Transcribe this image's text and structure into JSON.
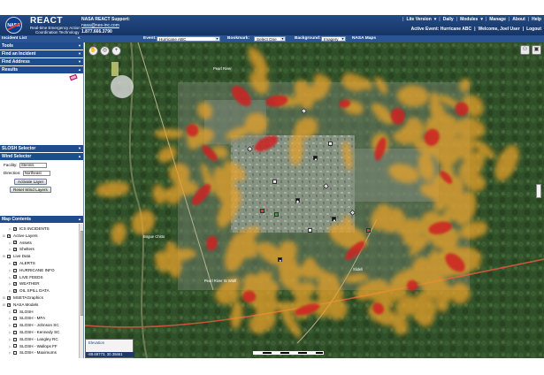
{
  "header": {
    "logo_text": "NASA",
    "title": "REACT",
    "subtitle_line1": "Real-time Emergency Action",
    "subtitle_line2": "Coordination Technology",
    "support_title": "NASA REACT Support:",
    "support_email": "nasa@nes-inc.com",
    "support_phone": "1.877.666.3790",
    "nav": [
      "Lite Version",
      "Daily",
      "Modules",
      "Manage",
      "About",
      "Help"
    ],
    "active_event": "Active Event: Hurricane ABC",
    "welcome": "Welcome, Joel User",
    "logout": "Logout"
  },
  "toolbar": {
    "incident_list": "Incident List",
    "event_label": "Event:",
    "event_value": "Hurricane ABC",
    "bookmark_label": "Bookmark:",
    "bookmark_value": "Select One",
    "background_label": "Background:",
    "background_value": "Imagery",
    "nasa_maps": "NASA Maps"
  },
  "sidebar": {
    "panels": [
      "Tools",
      "Find an Incident",
      "Find Address",
      "Results"
    ],
    "slosh_selector": "SLOSH Selector",
    "wind_selector": "Wind Selector",
    "facility_label": "Facility:",
    "facility_value": "Stennis",
    "direction_label": "Direction:",
    "direction_value": "Northeast",
    "activate_label": "Activate Layer",
    "reset_label": "Reset Wind Layers",
    "map_contents": "Map Contents",
    "tree": [
      {
        "label": "ICS INCIDENTS",
        "level": 2,
        "checked": true
      },
      {
        "label": "Active Layers",
        "level": 1,
        "checked": true
      },
      {
        "label": "Assets",
        "level": 2,
        "checked": true
      },
      {
        "label": "Shelters",
        "level": 2,
        "checked": true
      },
      {
        "label": "Live Data",
        "level": 1,
        "checked": false
      },
      {
        "label": "ALERTS",
        "level": 2,
        "checked": true
      },
      {
        "label": "HURRICANE INFO",
        "level": 2,
        "checked": false
      },
      {
        "label": "LIVE FEEDS",
        "level": 2,
        "checked": true
      },
      {
        "label": "WEATHER",
        "level": 2,
        "checked": true
      },
      {
        "label": "OIL SPILL DATA",
        "level": 2,
        "checked": true
      },
      {
        "label": "MSETAGraphics",
        "level": 1,
        "checked": true
      },
      {
        "label": "NASA Models",
        "level": 1,
        "checked": true
      },
      {
        "label": "SLOSH",
        "level": 2,
        "checked": false
      },
      {
        "label": "SLOSH - MFA",
        "level": 2,
        "checked": false
      },
      {
        "label": "SLOSH - Johnson SC",
        "level": 2,
        "checked": false
      },
      {
        "label": "SLOSH - Kennedy SC",
        "level": 2,
        "checked": false
      },
      {
        "label": "SLOSH - Langley RC",
        "level": 2,
        "checked": false
      },
      {
        "label": "SLOSH - Wallops FF",
        "level": 2,
        "checked": false
      },
      {
        "label": "SLOSH - Maximums",
        "level": 2,
        "checked": false
      }
    ]
  },
  "map": {
    "labels": [
      "Bogue Chitto",
      "Pearl River St Wldlf",
      "Pearl River",
      "Slidell"
    ],
    "overview_title": "Elevation",
    "coordinates": "-89.69773, 30.35661"
  }
}
